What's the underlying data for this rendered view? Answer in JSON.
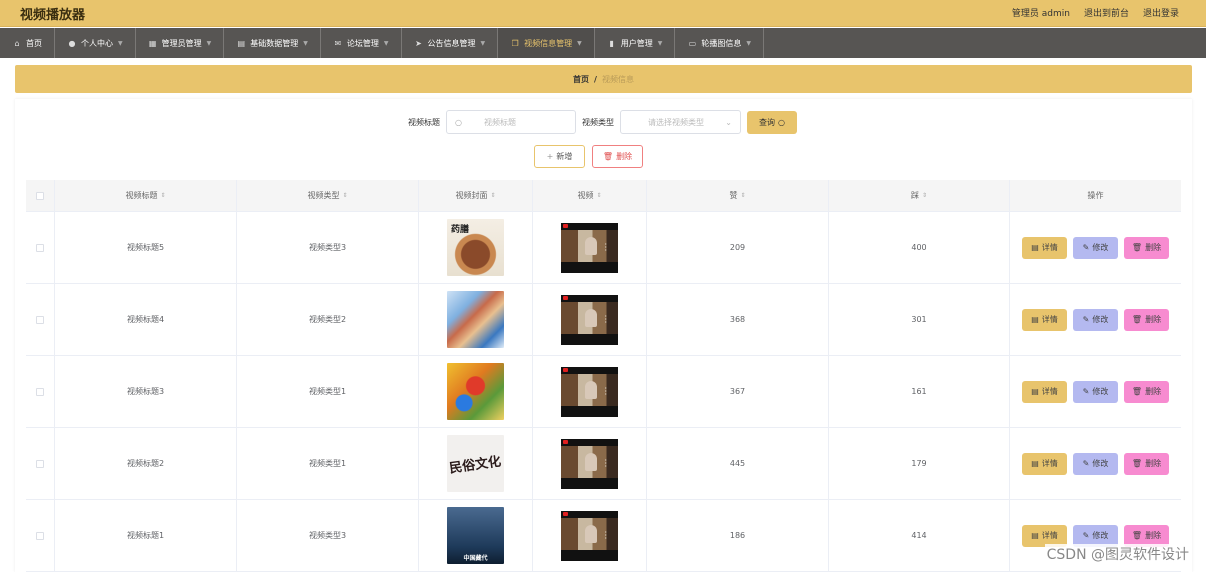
{
  "app": {
    "title": "视频播放器"
  },
  "header": {
    "user": "管理员 admin",
    "front_link": "退出到前台",
    "logout": "退出登录"
  },
  "nav": [
    {
      "label": "首页",
      "icon": "home-icon",
      "glyph": "⌂",
      "dropdown": false
    },
    {
      "label": "个人中心",
      "icon": "user-icon",
      "glyph": "👤",
      "dropdown": true
    },
    {
      "label": "管理员管理",
      "icon": "grid-icon",
      "glyph": "▦",
      "dropdown": true
    },
    {
      "label": "基础数据管理",
      "icon": "database-icon",
      "glyph": "▤",
      "dropdown": true
    },
    {
      "label": "论坛管理",
      "icon": "mail-icon",
      "glyph": "✉",
      "dropdown": true
    },
    {
      "label": "公告信息管理",
      "icon": "send-icon",
      "glyph": "➤",
      "dropdown": true
    },
    {
      "label": "视频信息管理",
      "icon": "copy-icon",
      "glyph": "❐",
      "dropdown": true,
      "active": true
    },
    {
      "label": "用户管理",
      "icon": "chart-icon",
      "glyph": "▮",
      "dropdown": true
    },
    {
      "label": "轮播图信息",
      "icon": "briefcase-icon",
      "glyph": "▭",
      "dropdown": true
    }
  ],
  "breadcrumb": {
    "home": "首页",
    "separator": "/",
    "current": "视频信息"
  },
  "search": {
    "title_label": "视频标题",
    "title_placeholder": "视频标题",
    "type_label": "视频类型",
    "type_placeholder": "请选择视频类型",
    "query_button": "查询"
  },
  "actions": {
    "add": "新增",
    "delete": "删除"
  },
  "table": {
    "columns": [
      "视频标题",
      "视频类型",
      "视频封面",
      "视频",
      "赞",
      "踩",
      "操作"
    ],
    "rows": [
      {
        "title": "视频标题5",
        "type": "视频类型3",
        "cover": "cover1",
        "cover_text": "药膳",
        "likes": "209",
        "dislikes": "400"
      },
      {
        "title": "视频标题4",
        "type": "视频类型2",
        "cover": "cover2",
        "cover_text": "",
        "likes": "368",
        "dislikes": "301"
      },
      {
        "title": "视频标题3",
        "type": "视频类型1",
        "cover": "cover3",
        "cover_text": "",
        "likes": "367",
        "dislikes": "161"
      },
      {
        "title": "视频标题2",
        "type": "视频类型1",
        "cover": "cover4",
        "cover_text": "民俗文化",
        "likes": "445",
        "dislikes": "179"
      },
      {
        "title": "视频标题1",
        "type": "视频类型3",
        "cover": "cover5",
        "cover_text": "中国藏代",
        "likes": "186",
        "dislikes": "414"
      }
    ],
    "row_actions": {
      "detail": "详情",
      "edit": "修改",
      "delete": "删除"
    }
  },
  "watermark": "CSDN @图灵软件设计"
}
